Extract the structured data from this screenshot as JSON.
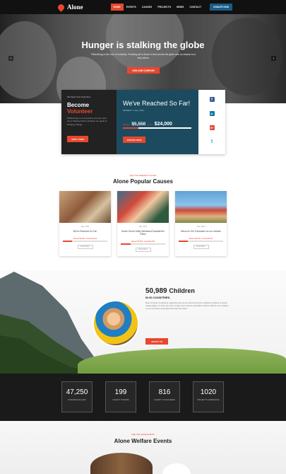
{
  "nav": {
    "logo": "Alone",
    "items": [
      "HOME",
      "EVENTS",
      "CAUSES",
      "PROJECTS",
      "NEWS",
      "CONTACT"
    ],
    "donate": "DONATE NOW"
  },
  "hero": {
    "title": "Hunger is stalking the globe",
    "subtitle": "Philanthropy is the love of humanity. Providing aid to those in need across the globe and our mission is to help others.",
    "button": "JOIN OUR COMPANY",
    "prev": "‹",
    "next": "›"
  },
  "volunteer": {
    "small": "We Need Your Help Now",
    "title1": "Become",
    "title2": "Volunteer",
    "desc": "Philanthropy is our keystone and we need every helping hand to achieve our goals of bringing change.",
    "button": "APPLY NOW"
  },
  "reached": {
    "title": "We've Reached So Far!",
    "date": "MONDAY 1 JUL, 2017",
    "raised_label": "Raised",
    "raised": "$5,550",
    "goal_label": "Goal",
    "goal": "$24,000",
    "progress": 0.23,
    "button": "DONATE NOW"
  },
  "social": [
    "f",
    "in",
    "G+",
    "t"
  ],
  "causes": {
    "small": "HELP THE NEEDIEST CAUSES",
    "title": "Alone Popular Causes",
    "cards": [
      {
        "date": "JUL, 2017",
        "title": "We've Reached So Far!",
        "raised": "Raised $2,000 / Goal $10,000",
        "progress": 0.2,
        "button": "Read More"
      },
      {
        "date": "JUL, 2017",
        "title": "Seven Drone Softly Westward Downfall the Rides",
        "raised": "Raised $5,550 / Goal $24,000",
        "progress": 0.23,
        "button": "Read More"
      },
      {
        "date": "JUL, 2017",
        "title": "School Is Out Fundraiser for our children",
        "raised": "Raised $3,000 / Goal $15,000",
        "progress": 0.2,
        "button": "Read More"
      }
    ]
  },
  "children": {
    "count": "50,989",
    "word": "Children",
    "sub": "IN 60 COUNTRIES.",
    "desc": "Dolor sit amet consectetur adipiscing elit sed do eiusmod tempor incididunt ut labore et dolore magna aliqua. Ut enim ad minim veniam quis nostrud exercitation ullamco laboris nisi ut aliquip ex ea commodo consequat duis aute irure dolor.",
    "button": "ABOUT US"
  },
  "stats": [
    {
      "num": "47,250",
      "label": "Donated Dollars"
    },
    {
      "num": "199",
      "label": "Charity Donors"
    },
    {
      "num": "816",
      "label": "Charity Volunteers"
    },
    {
      "num": "1020",
      "label": "Projects Completed"
    }
  ],
  "events": {
    "small": "FIND THE CAUSE EVENTS",
    "title": "Alone Welfare Events"
  }
}
